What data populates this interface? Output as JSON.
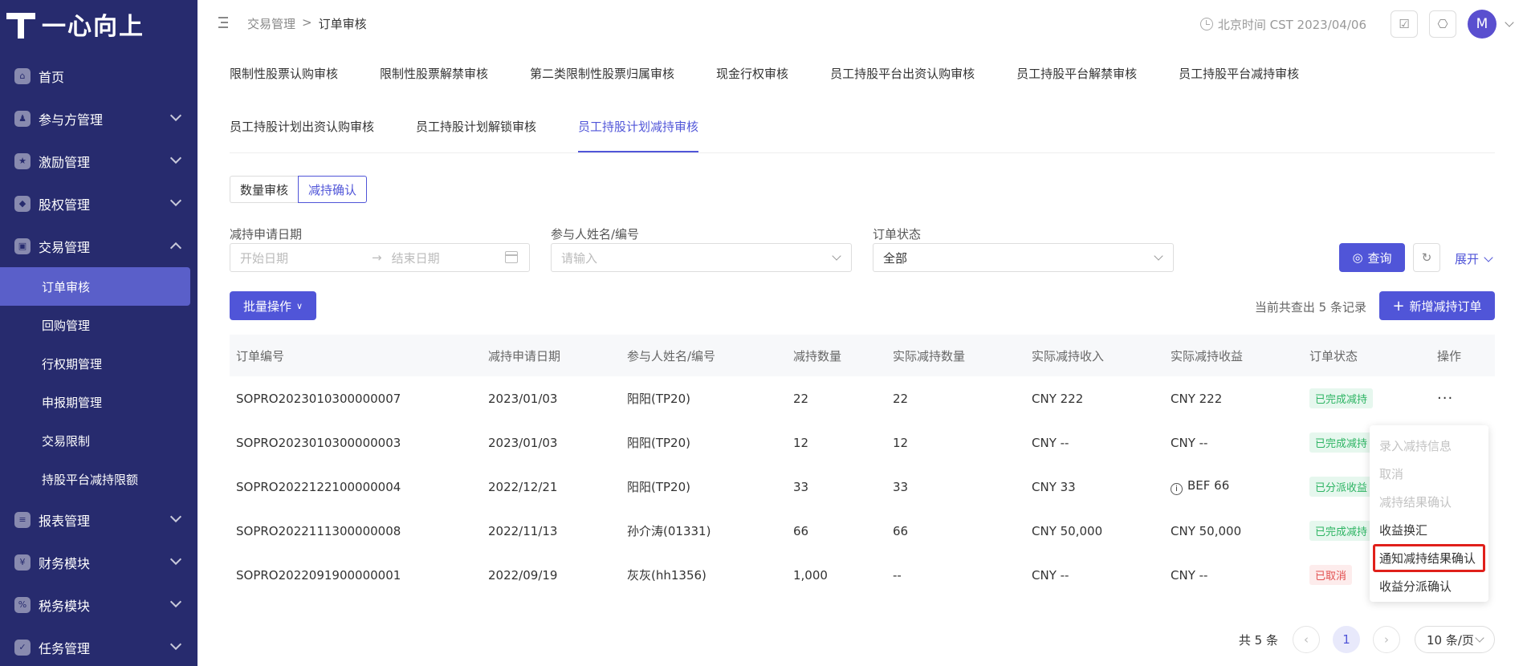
{
  "brand": {
    "name": "一心向上"
  },
  "sidebar": {
    "items": [
      {
        "label": "首页",
        "icon": "home-icon",
        "expandable": false
      },
      {
        "label": "参与方管理",
        "icon": "participants-icon",
        "expandable": true
      },
      {
        "label": "激励管理",
        "icon": "incentive-icon",
        "expandable": true
      },
      {
        "label": "股权管理",
        "icon": "equity-icon",
        "expandable": true
      },
      {
        "label": "交易管理",
        "icon": "trade-icon",
        "expandable": true,
        "expanded": true
      },
      {
        "label": "报表管理",
        "icon": "report-icon",
        "expandable": true
      },
      {
        "label": "财务模块",
        "icon": "finance-icon",
        "expandable": true
      },
      {
        "label": "税务模块",
        "icon": "tax-icon",
        "expandable": true
      },
      {
        "label": "任务管理",
        "icon": "task-icon",
        "expandable": true
      }
    ],
    "sub_items": [
      {
        "label": "订单审核",
        "active": true
      },
      {
        "label": "回购管理"
      },
      {
        "label": "行权期管理"
      },
      {
        "label": "申报期管理"
      },
      {
        "label": "交易限制"
      },
      {
        "label": "持股平台减持限额"
      }
    ]
  },
  "header": {
    "breadcrumb": [
      "交易管理",
      "订单审核"
    ],
    "time": "北京时间 CST 2023/04/06",
    "avatar": "M"
  },
  "tabs": {
    "row1": [
      "限制性股票认购审核",
      "限制性股票解禁审核",
      "第二类限制性股票归属审核",
      "现金行权审核",
      "员工持股平台出资认购审核",
      "员工持股平台解禁审核",
      "员工持股平台减持审核"
    ],
    "row2": [
      "员工持股计划出资认购审核",
      "员工持股计划解锁审核",
      "员工持股计划减持审核"
    ],
    "active": "员工持股计划减持审核"
  },
  "segments": {
    "items": [
      "数量审核",
      "减持确认"
    ],
    "active": "减持确认"
  },
  "filters": {
    "date_label": "减持申请日期",
    "start_placeholder": "开始日期",
    "end_placeholder": "结束日期",
    "participant_label": "参与人姓名/编号",
    "participant_placeholder": "请输入",
    "status_label": "订单状态",
    "status_value": "全部"
  },
  "actions": {
    "query": "查询",
    "expand": "展开",
    "batch": "批量操作",
    "count_text": "当前共查出 5 条记录",
    "add": "新增减持订单"
  },
  "table": {
    "columns": [
      "订单编号",
      "减持申请日期",
      "参与人姓名/编号",
      "减持数量",
      "实际减持数量",
      "实际减持收入",
      "实际减持收益",
      "订单状态",
      "操作"
    ],
    "rows": [
      {
        "id": "SOPRO2023010300000007",
        "date": "2023/01/03",
        "person": "阳阳(TP20)",
        "qty": "22",
        "actual_qty": "22",
        "income": "CNY 222",
        "profit": "CNY 222",
        "status": "已完成减持",
        "status_color": "green"
      },
      {
        "id": "SOPRO2023010300000003",
        "date": "2023/01/03",
        "person": "阳阳(TP20)",
        "qty": "12",
        "actual_qty": "12",
        "income": "CNY --",
        "profit": "CNY --",
        "status": "已完成减持",
        "status_color": "green"
      },
      {
        "id": "SOPRO2022122100000004",
        "date": "2022/12/21",
        "person": "阳阳(TP20)",
        "qty": "33",
        "actual_qty": "33",
        "income": "CNY 33",
        "profit": "BEF 66",
        "status": "已分派收益",
        "status_color": "green",
        "profit_info": true
      },
      {
        "id": "SOPRO2022111300000008",
        "date": "2022/11/13",
        "person": "孙介涛(01331)",
        "qty": "66",
        "actual_qty": "66",
        "income": "CNY 50,000",
        "profit": "CNY 50,000",
        "status": "已完成减持",
        "status_color": "green"
      },
      {
        "id": "SOPRO2022091900000001",
        "date": "2022/09/19",
        "person": "灰灰(hh1356)",
        "qty": "1,000",
        "actual_qty": "--",
        "income": "CNY --",
        "profit": "CNY --",
        "status": "已取消",
        "status_color": "red"
      }
    ]
  },
  "popup_menu": {
    "items": [
      {
        "label": "录入减持信息",
        "disabled": true
      },
      {
        "label": "取消",
        "disabled": true
      },
      {
        "label": "减持结果确认",
        "disabled": true
      },
      {
        "label": "收益换汇",
        "disabled": false
      },
      {
        "label": "通知减持结果确认",
        "disabled": false,
        "highlighted": true
      },
      {
        "label": "收益分派确认",
        "disabled": false
      }
    ]
  },
  "pagination": {
    "total": "共 5 条",
    "current": "1",
    "page_size": "10 条/页"
  }
}
